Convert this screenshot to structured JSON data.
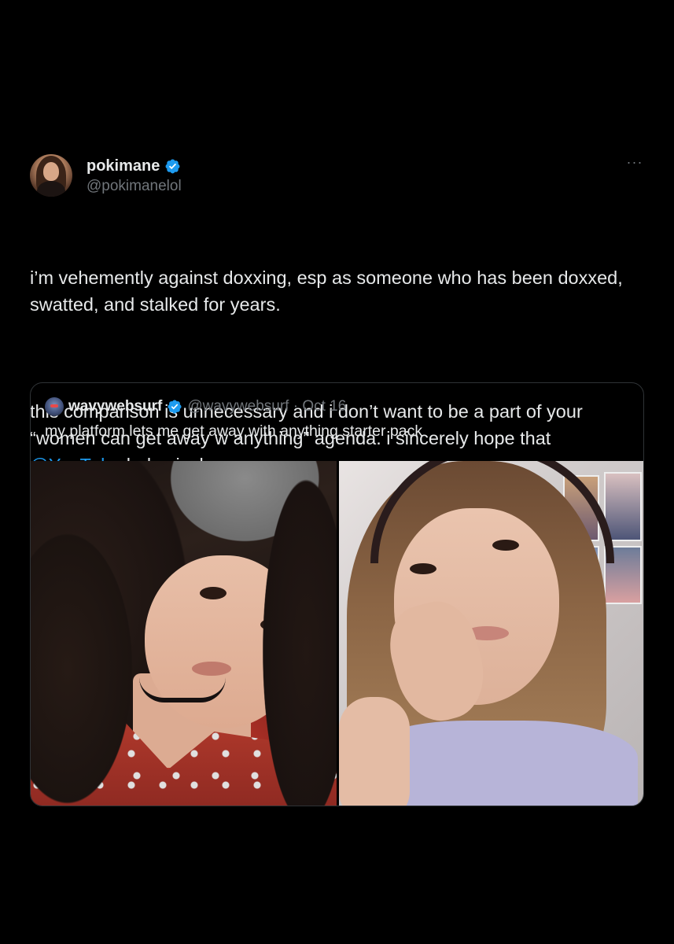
{
  "tweet": {
    "display_name": "pokimane",
    "handle": "@pokimanelol",
    "verified": true,
    "more_label": "···",
    "text_para1": "i’m vehemently against doxxing, esp as someone who has been doxxed, swatted, and stalked for years.",
    "text_para2_before_mention": "this comparison is unnecessary and i don’t want to be a part of your “women can get away w anything” agenda. i sincerely hope that ",
    "mention": "@YouTube",
    "text_para2_after_mention": " helps jack."
  },
  "quote": {
    "display_name": "wavywebsurf",
    "verified": true,
    "handle_and_date": "@wavywebsurf · Oct 16",
    "text": "my platform lets me get away with anything starter pack"
  },
  "colors": {
    "background": "#000000",
    "text": "#e7e9ea",
    "secondary_text": "#71767b",
    "link": "#1d9bf0",
    "verified_badge": "#1d9bf0",
    "border": "#2f3336"
  }
}
